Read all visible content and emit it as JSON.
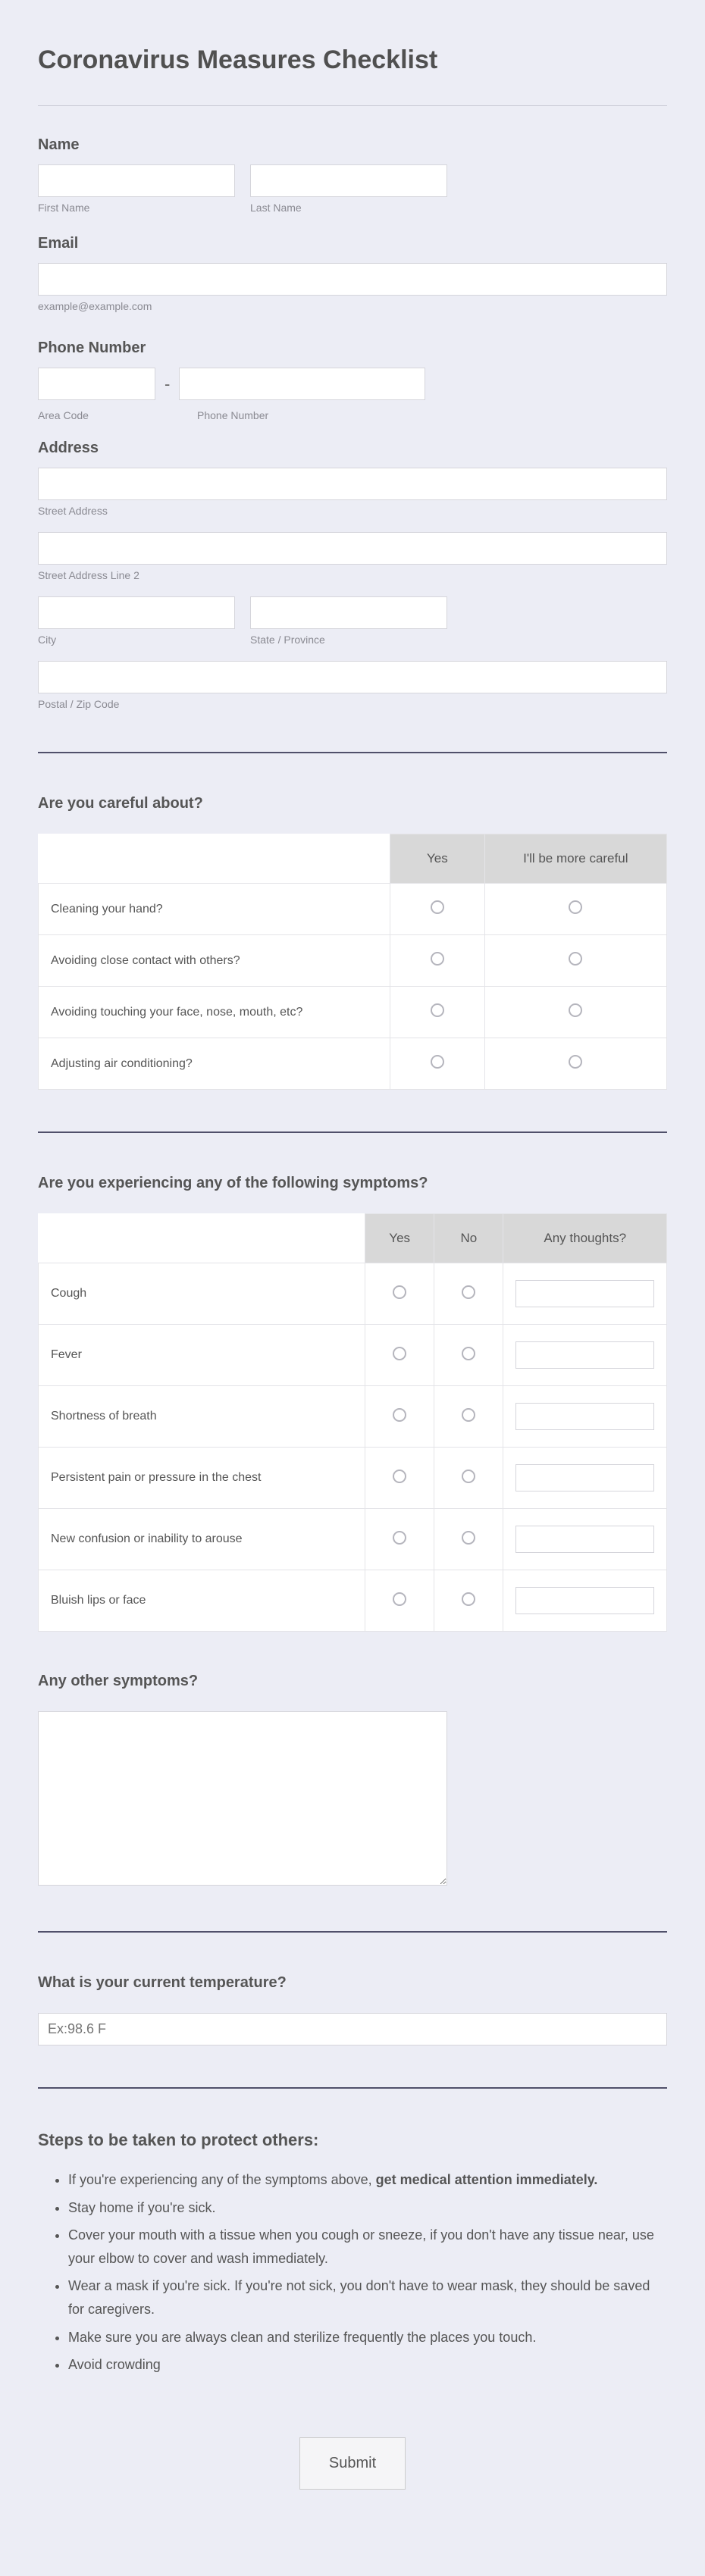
{
  "title": "Coronavirus Measures Checklist",
  "fields": {
    "name": {
      "label": "Name",
      "first_sub": "First Name",
      "last_sub": "Last Name"
    },
    "email": {
      "label": "Email",
      "hint": "example@example.com"
    },
    "phone": {
      "label": "Phone Number",
      "code_sub": "Area Code",
      "num_sub": "Phone Number",
      "dash": "-"
    },
    "address": {
      "label": "Address",
      "street_sub": "Street Address",
      "street2_sub": "Street Address Line 2",
      "city_sub": "City",
      "state_sub": "State / Province",
      "zip_sub": "Postal / Zip Code"
    }
  },
  "careful": {
    "heading": "Are you careful about?",
    "cols": [
      "Yes",
      "I'll be more careful"
    ],
    "rows": [
      "Cleaning your hand?",
      "Avoiding close contact with others?",
      "Avoiding touching your face, nose, mouth, etc?",
      "Adjusting air conditioning?"
    ]
  },
  "symptoms": {
    "heading": "Are you experiencing any of the following symptoms?",
    "cols": [
      "Yes",
      "No",
      "Any thoughts?"
    ],
    "rows": [
      "Cough",
      "Fever",
      "Shortness of breath",
      "Persistent pain or pressure in the chest",
      "New confusion or inability to arouse",
      "Bluish lips or face"
    ]
  },
  "other_symptoms": {
    "label": "Any other symptoms?"
  },
  "temperature": {
    "label": "What is your current temperature?",
    "placeholder": "Ex:98.6 F"
  },
  "steps": {
    "heading": "Steps to be taken to protect others:",
    "items": [
      {
        "pre": "If you're experiencing any of the symptoms above, ",
        "bold": "get medical attention immediately."
      },
      {
        "text": "Stay home if you're sick."
      },
      {
        "text": "Cover your mouth with a tissue when you cough or sneeze, if you don't have any tissue near, use your elbow to cover and wash immediately."
      },
      {
        "text": "Wear a mask if you're sick. If you're not sick, you don't have to wear mask, they should be saved for caregivers."
      },
      {
        "text": "Make sure you are always clean and sterilize frequently the places you touch."
      },
      {
        "text": "Avoid crowding"
      }
    ]
  },
  "submit": "Submit"
}
